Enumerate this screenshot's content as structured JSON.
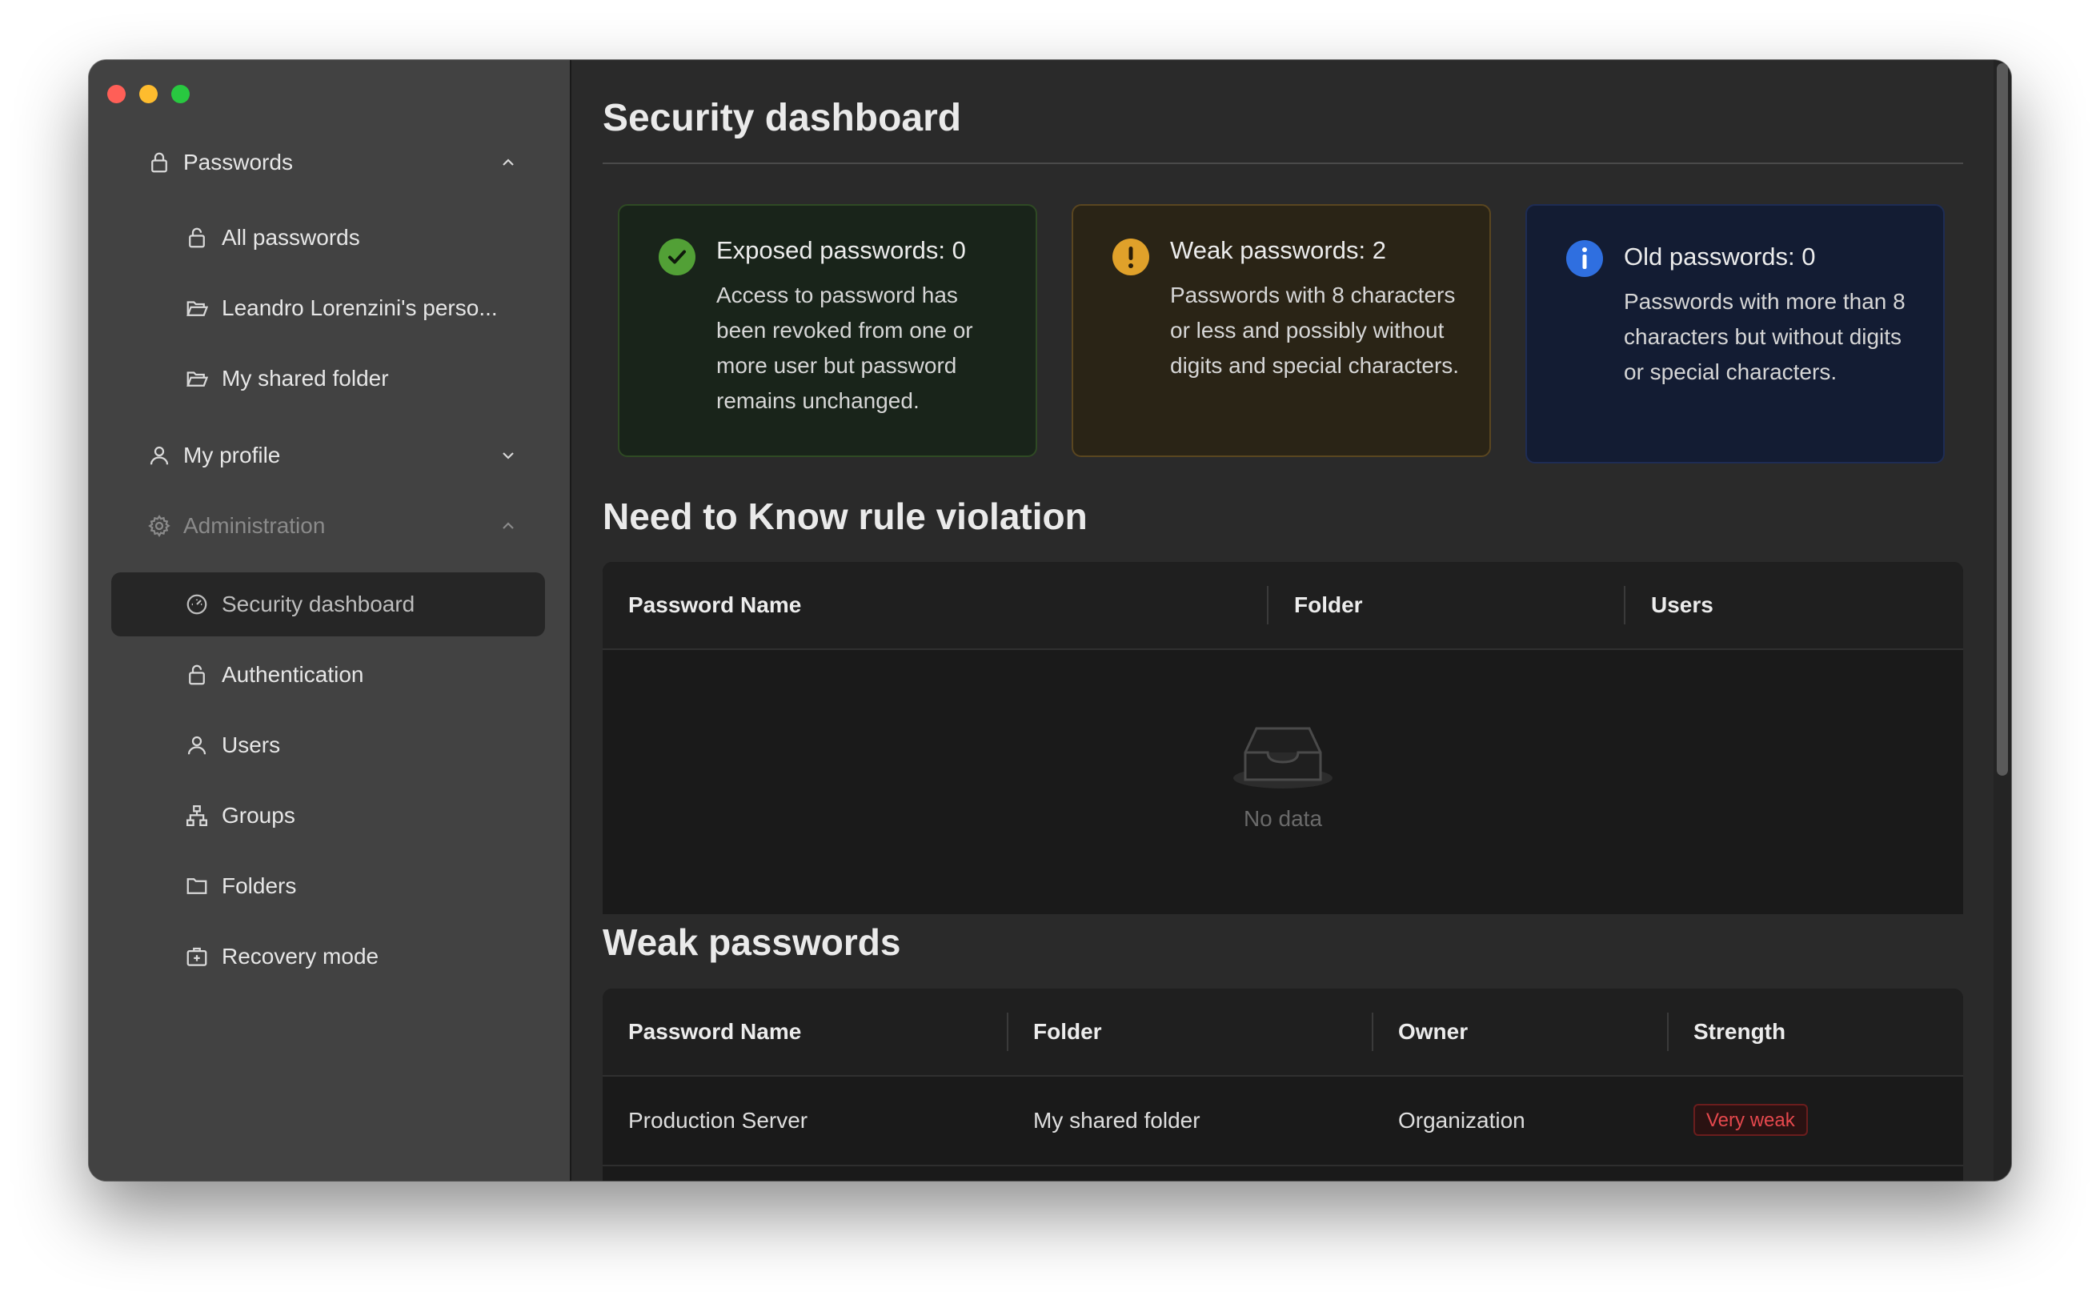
{
  "sidebar": {
    "items": [
      {
        "label": "Passwords"
      },
      {
        "label": "All passwords"
      },
      {
        "label": "Leandro Lorenzini's perso..."
      },
      {
        "label": "My shared folder"
      },
      {
        "label": "My profile"
      },
      {
        "label": "Administration"
      },
      {
        "label": "Security dashboard"
      },
      {
        "label": "Authentication"
      },
      {
        "label": "Users"
      },
      {
        "label": "Groups"
      },
      {
        "label": "Folders"
      },
      {
        "label": "Recovery mode"
      }
    ]
  },
  "main": {
    "title": "Security dashboard",
    "cards": [
      {
        "title": "Exposed passwords: 0",
        "description": "Access to password has been revoked from one or more user but password remains unchanged.",
        "color": "#52a036"
      },
      {
        "title": "Weak passwords: 2",
        "description": "Passwords with 8 characters or less and possibly without digits and special characters.",
        "color": "#e0a12a"
      },
      {
        "title": "Old passwords: 0",
        "description": "Passwords with more than 8 characters but without digits or special characters.",
        "color": "#2f6fe0"
      }
    ],
    "ntk": {
      "title": "Need to Know rule violation",
      "columns": [
        "Password Name",
        "Folder",
        "Users"
      ],
      "empty_text": "No data"
    },
    "weak": {
      "title": "Weak passwords",
      "columns": [
        "Password Name",
        "Folder",
        "Owner",
        "Strength"
      ],
      "rows": [
        {
          "name": "Production Server",
          "folder": "My shared folder",
          "owner": "Organization",
          "strength": "Very weak"
        }
      ]
    }
  }
}
